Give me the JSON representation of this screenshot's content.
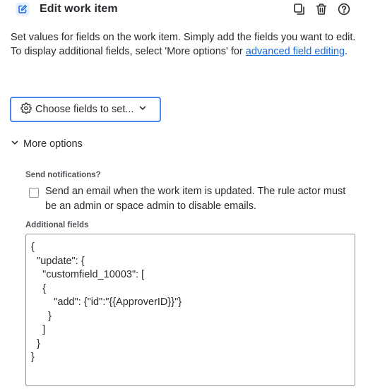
{
  "header": {
    "title": "Edit work item",
    "icons": {
      "edit": "pencil-square-icon",
      "copy": "copy-icon",
      "delete": "trash-icon",
      "help": "help-circle-icon"
    }
  },
  "description": {
    "line1": "Set values for fields on the work item. Simply add the fields you want to edit.",
    "line2_prefix": "To display additional fields, select 'More options' for ",
    "line2_link": "advanced field editing",
    "line2_suffix": "."
  },
  "choose_fields": {
    "label": "Choose fields to set..."
  },
  "more_options": {
    "label": "More options",
    "expanded": true
  },
  "send_notifications": {
    "label": "Send notifications?",
    "checkbox_text": "Send an email when the work item is updated. The rule actor must be an admin or space admin to disable emails.",
    "checked": false
  },
  "additional_fields": {
    "label": "Additional fields",
    "value": "{\n  \"update\": {\n    \"customfield_10003\": [\n    {\n        \"add\": {\"id\":\"{{ApproverID}}\"}\n      }\n    ]\n  }\n}"
  },
  "colors": {
    "link": "#1868db",
    "focus_border": "#4688ec",
    "text": "#292a2e",
    "label": "#505258"
  }
}
